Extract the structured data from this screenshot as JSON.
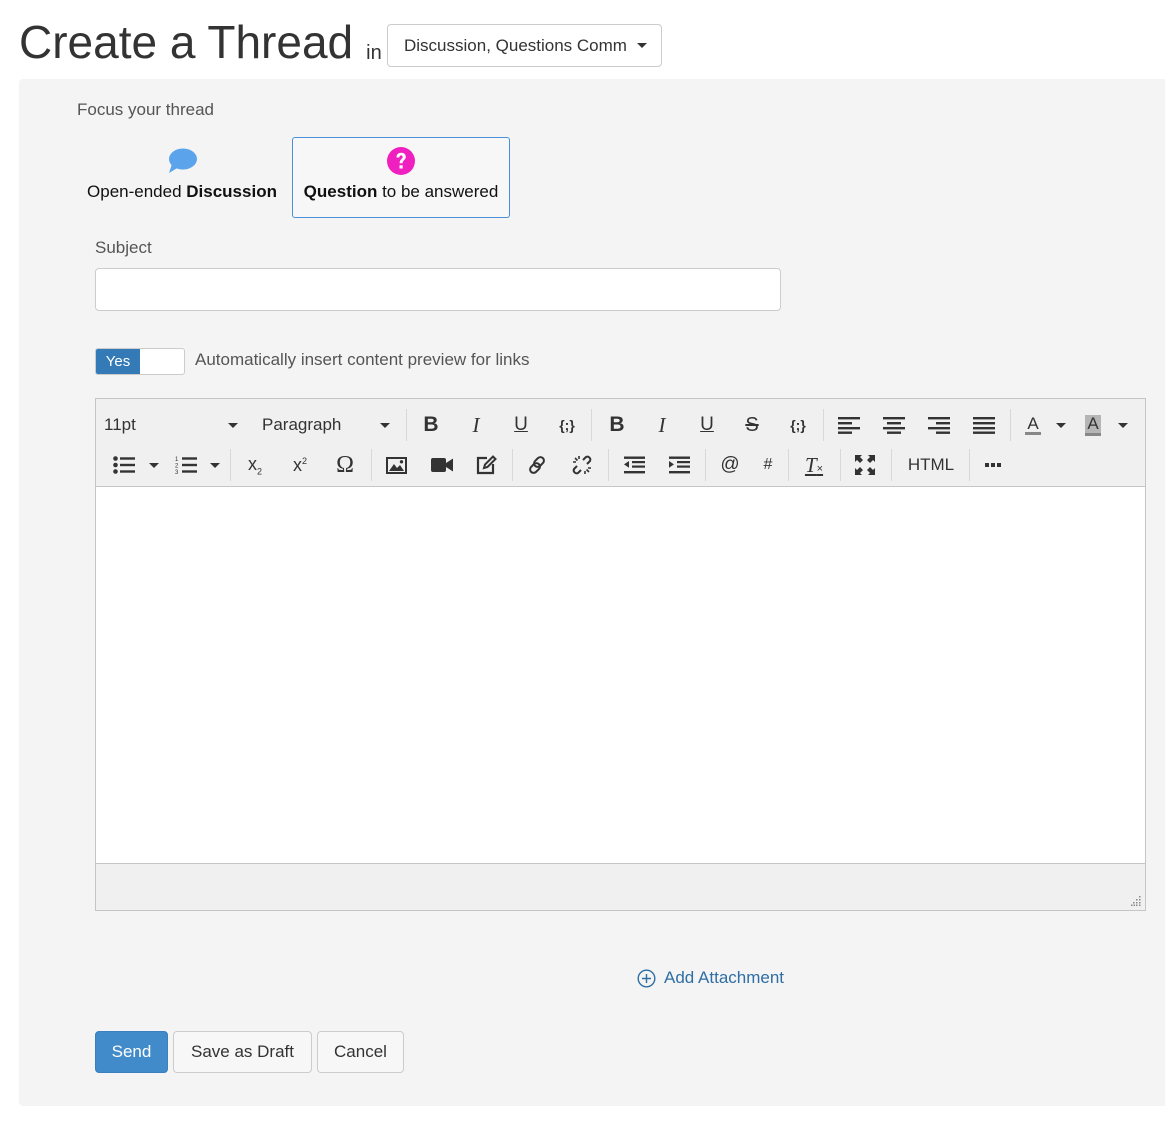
{
  "header": {
    "title": "Create a Thread",
    "in_label": "in",
    "forum_select": {
      "value": "Discussion, Questions Comm"
    }
  },
  "focus": {
    "label": "Focus your thread",
    "options": [
      {
        "icon": "speech-bubble-icon",
        "prefix": "Open-ended ",
        "bold": "Discussion",
        "suffix": "",
        "selected": false,
        "color": "#5ba3ea"
      },
      {
        "icon": "question-circle-icon",
        "prefix": "",
        "bold": "Question",
        "suffix": " to be answered",
        "selected": true,
        "color": "#f020c0"
      }
    ]
  },
  "subject": {
    "label": "Subject",
    "value": "",
    "placeholder": ""
  },
  "link_preview": {
    "toggle_value": "Yes",
    "label": "Automatically insert content preview for links"
  },
  "editor": {
    "font_size": "11pt",
    "block_format": "Paragraph",
    "toolbar_row1": [
      "bold",
      "italic",
      "underline",
      "code",
      "bold",
      "italic",
      "underline",
      "strikethrough",
      "code",
      "align-left",
      "align-center",
      "align-right",
      "align-justify",
      "text-color",
      "background-color"
    ],
    "toolbar_row2": [
      "bullet-list",
      "numbered-list",
      "subscript",
      "superscript",
      "special-character",
      "image",
      "video",
      "edit",
      "link",
      "unlink",
      "outdent",
      "indent",
      "mention",
      "hashtag",
      "clear-formatting",
      "fullscreen",
      "html",
      "more"
    ],
    "html_label": "HTML",
    "mention_label": "@",
    "hashtag_label": "#",
    "content": ""
  },
  "attachment": {
    "label": "Add Attachment"
  },
  "actions": {
    "send": "Send",
    "save_draft": "Save as Draft",
    "cancel": "Cancel"
  },
  "colors": {
    "primary": "#428bca",
    "toggle_on": "#337ab7",
    "link": "#2f6ea5",
    "selected_border": "#4a90d9"
  }
}
